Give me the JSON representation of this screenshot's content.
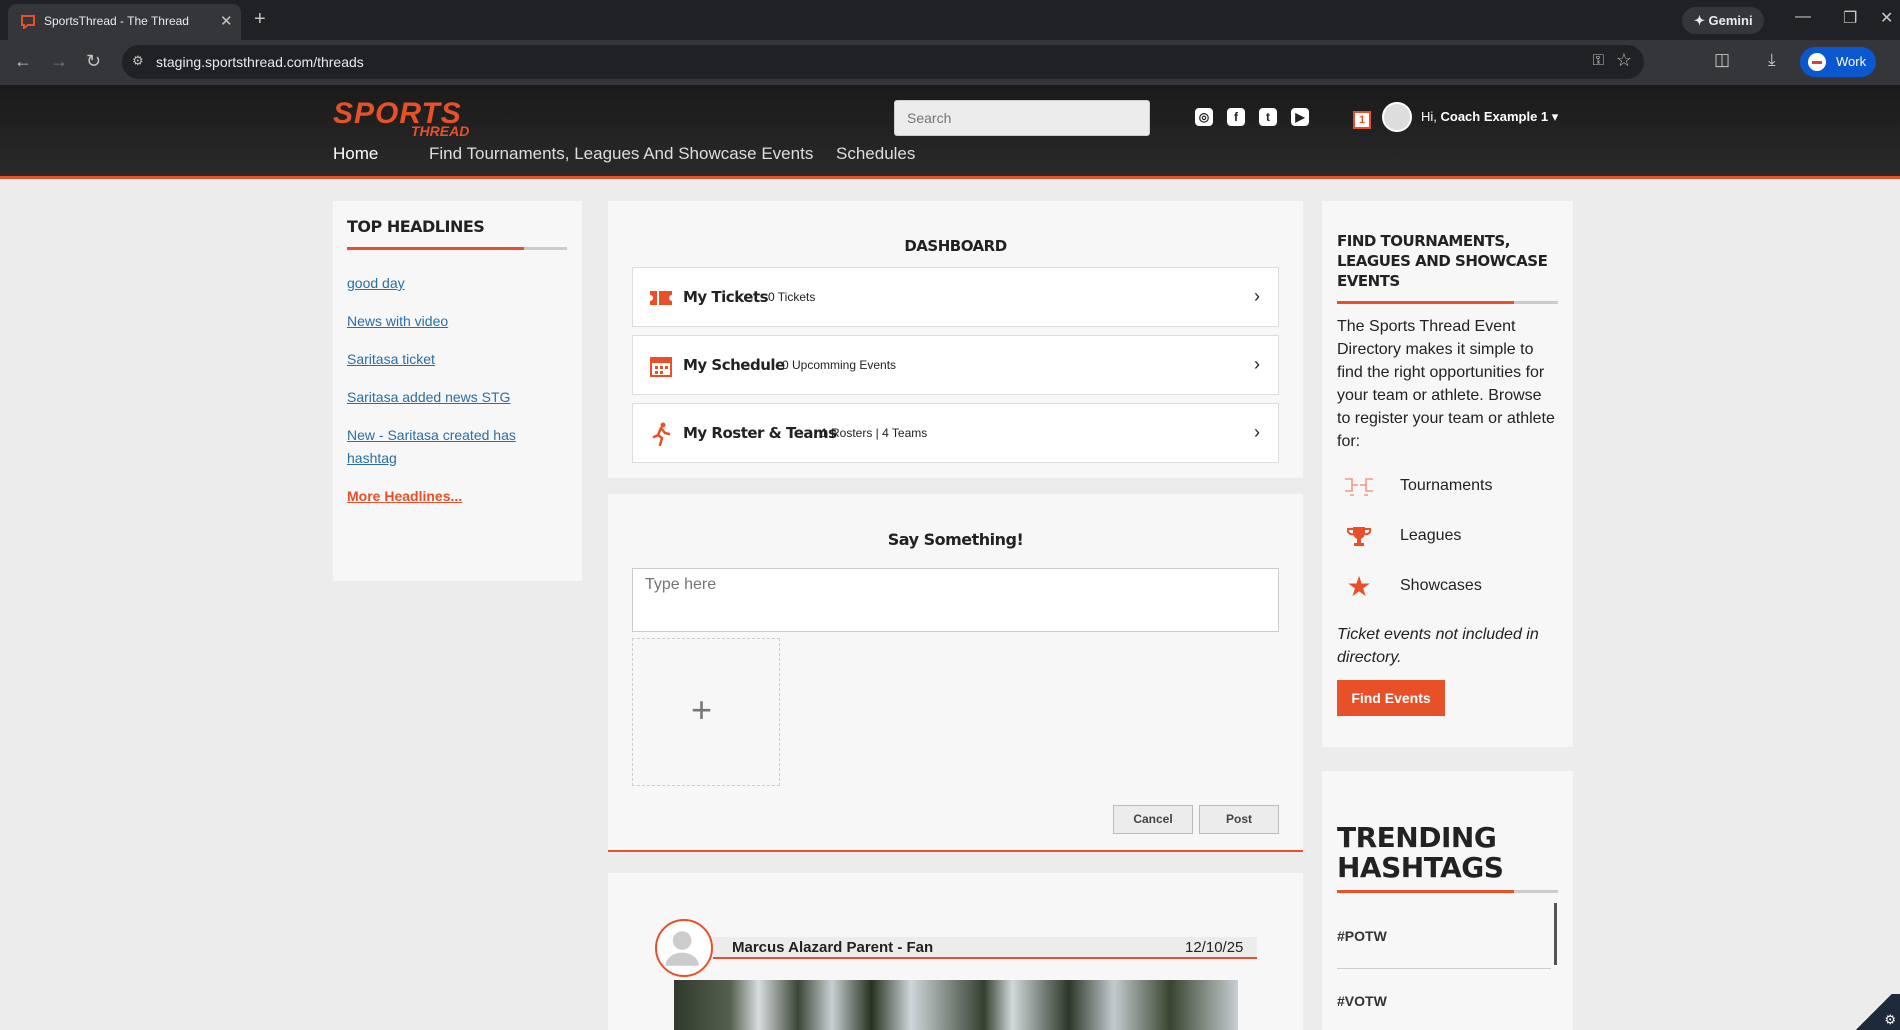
{
  "browser": {
    "tab_title": "SportsThread - The Thread",
    "url": "staging.sportsthread.com/threads",
    "gemini_label": "Gemini",
    "profile_label": "Work"
  },
  "header": {
    "logo_top": "SPORTS",
    "logo_bottom": "THREAD",
    "search_placeholder": "Search",
    "notification_count": "1",
    "greeting_prefix": "Hi, ",
    "user_name": "Coach Example 1",
    "menu": [
      "Home",
      "Find Tournaments, Leagues And Showcase Events",
      "Schedules"
    ]
  },
  "headlines": {
    "title": "TOP HEADLINES",
    "items": [
      "good day",
      "News with video",
      "Saritasa ticket",
      "Saritasa added news STG",
      "New - Saritasa created has",
      "hashtag"
    ],
    "more": "More Headlines..."
  },
  "dashboard": {
    "title": "DASHBOARD",
    "items": [
      {
        "label": "My Tickets",
        "count": "0 Tickets",
        "icon": "ticket-icon"
      },
      {
        "label": "My Schedule",
        "count": "0 Upcomming Events",
        "icon": "calendar-icon"
      },
      {
        "label": "My Roster & Teams",
        "count": "1 Rosters | 4 Teams",
        "icon": "runner-icon"
      }
    ]
  },
  "compose": {
    "title": "Say Something!",
    "placeholder": "Type here",
    "cancel": "Cancel",
    "post": "Post"
  },
  "post": {
    "author": "Marcus Alazard Parent - Fan",
    "date": "12/10/25"
  },
  "directory": {
    "title_lines": [
      "FIND TOURNAMENTS,",
      "LEAGUES AND SHOWCASE",
      "EVENTS"
    ],
    "description_lines": [
      "The Sports Thread Event",
      "Directory makes it simple to",
      "find the right opportunities for",
      "your team or athlete. Browse",
      "to register your team or athlete",
      "for:"
    ],
    "categories": [
      {
        "label": "Tournaments",
        "icon": "bracket-icon"
      },
      {
        "label": "Leagues",
        "icon": "trophy-icon"
      },
      {
        "label": "Showcases",
        "icon": "star-icon"
      }
    ],
    "note_lines": [
      "Ticket events not included in",
      "directory."
    ],
    "button": "Find Events"
  },
  "trending": {
    "title_lines": [
      "TRENDING",
      "HASHTAGS"
    ],
    "tags": [
      "#POTW",
      "#VOTW"
    ]
  },
  "colors": {
    "accent": "#e8502a",
    "link": "#2a6ea6"
  }
}
